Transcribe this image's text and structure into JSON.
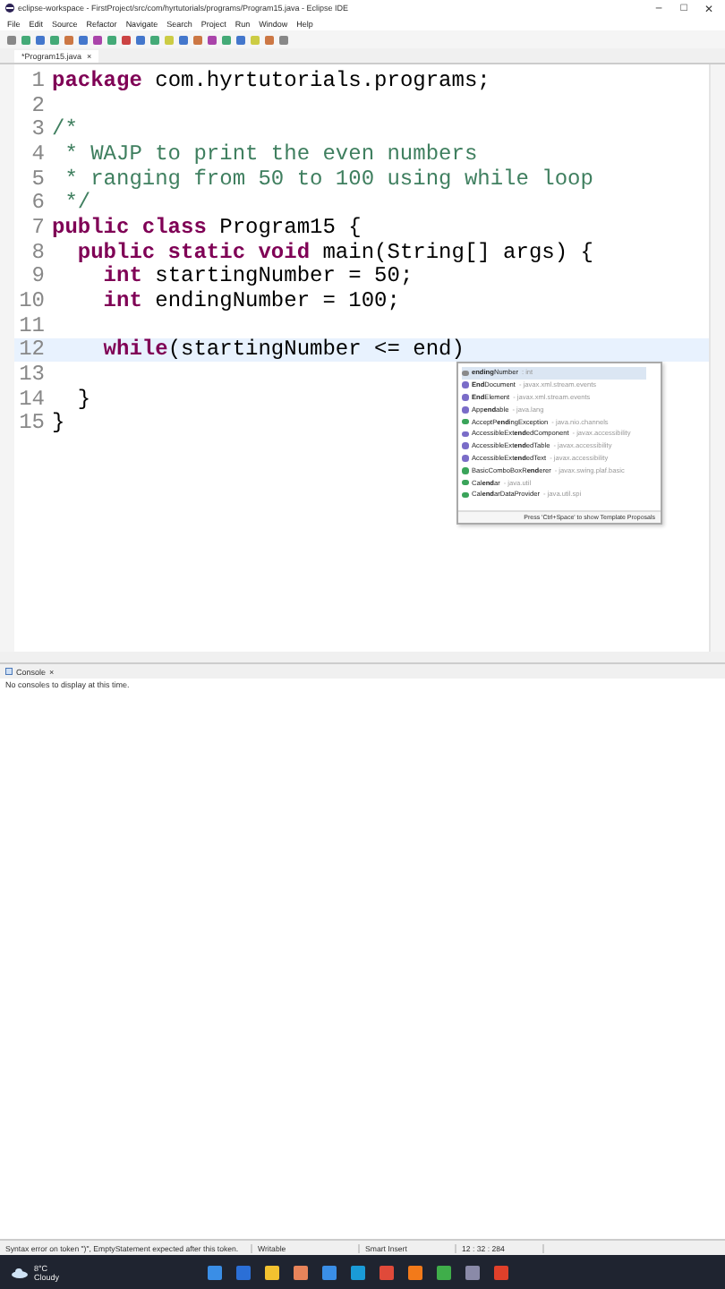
{
  "window": {
    "title": "eclipse-workspace - FirstProject/src/com/hyrtutorials/programs/Program15.java - Eclipse IDE",
    "controls": [
      "–",
      "□",
      "✕"
    ]
  },
  "menu": [
    "File",
    "Edit",
    "Source",
    "Refactor",
    "Navigate",
    "Search",
    "Project",
    "Run",
    "Window",
    "Help"
  ],
  "editor_tab": {
    "label": "*Program15.java",
    "close": "×"
  },
  "code_lines": [
    {
      "number": "1",
      "current": false,
      "segments": [
        {
          "kind": "keyword",
          "text": "package"
        },
        {
          "kind": "plain",
          "text": " com.hyrtutorials.programs;"
        }
      ]
    },
    {
      "number": "2",
      "current": false
    },
    {
      "number": "3",
      "current": false,
      "segments": [
        {
          "kind": "comment",
          "text": "/*"
        }
      ]
    },
    {
      "number": "4",
      "current": false,
      "segments": [
        {
          "kind": "comment",
          "text": " * WAJP to print the even numbers"
        }
      ]
    },
    {
      "number": "5",
      "current": false,
      "segments": [
        {
          "kind": "comment",
          "text": " * ranging from 50 to 100 using while loop"
        }
      ]
    },
    {
      "number": "6",
      "current": false,
      "segments": [
        {
          "kind": "comment",
          "text": " */"
        }
      ]
    },
    {
      "number": "7",
      "current": false,
      "segments": [
        {
          "kind": "keyword",
          "text": "public class"
        },
        {
          "kind": "plain",
          "text": " Program15 {"
        }
      ]
    },
    {
      "number": "8",
      "current": false,
      "segments": [
        {
          "kind": "keyword",
          "text": "  public static void"
        },
        {
          "kind": "plain",
          "text": " main(String[] args) {"
        }
      ]
    },
    {
      "number": "9",
      "current": false,
      "segments": [
        {
          "kind": "keyword",
          "text": "    int"
        },
        {
          "kind": "plain",
          "text": " startingNumber = 50;"
        }
      ]
    },
    {
      "number": "10",
      "current": false,
      "segments": [
        {
          "kind": "keyword",
          "text": "    int"
        },
        {
          "kind": "plain",
          "text": " endingNumber = 100;"
        }
      ]
    },
    {
      "number": "11",
      "current": false
    },
    {
      "number": "12",
      "current": true,
      "segments": [
        {
          "kind": "keyword",
          "text": "    while"
        },
        {
          "kind": "plain",
          "text": "(startingNumber <= end)"
        }
      ]
    },
    {
      "number": "13",
      "current": false
    },
    {
      "number": "14",
      "current": false,
      "segments": [
        {
          "kind": "plain",
          "text": "  }"
        }
      ]
    },
    {
      "number": "15",
      "current": false,
      "segments": [
        {
          "kind": "plain",
          "text": "}"
        }
      ]
    }
  ],
  "completion": {
    "items": [
      {
        "kind": "field",
        "name": "**ending**Number",
        "detail": ": int",
        "selected": true
      },
      {
        "kind": "interface",
        "name": "**End**Document",
        "detail": "- javax.xml.stream.events",
        "selected": false
      },
      {
        "kind": "interface",
        "name": "**End**Element",
        "detail": "- javax.xml.stream.events",
        "selected": false
      },
      {
        "kind": "interface",
        "name": "App**end**able",
        "detail": "- java.lang",
        "selected": false
      },
      {
        "kind": "class",
        "name": "AcceptP**end**ingException",
        "detail": "- java.nio.channels",
        "selected": false
      },
      {
        "kind": "interface",
        "name": "AccessibleExt**end**edComponent",
        "detail": "- javax.accessibility",
        "selected": false
      },
      {
        "kind": "interface",
        "name": "AccessibleExt**end**edTable",
        "detail": "- javax.accessibility",
        "selected": false
      },
      {
        "kind": "interface",
        "name": "AccessibleExt**end**edText",
        "detail": "- javax.accessibility",
        "selected": false
      },
      {
        "kind": "class",
        "name": "BasicComboBoxR**end**erer",
        "detail": "- javax.swing.plaf.basic",
        "selected": false
      },
      {
        "kind": "class",
        "name": "Cal**end**ar",
        "detail": "- java.util",
        "selected": false
      },
      {
        "kind": "class",
        "name": "Cal**end**arDataProvider",
        "detail": "- java.util.spi",
        "selected": false
      }
    ],
    "footer": "Press 'Ctrl+Space' to show Template Proposals"
  },
  "console": {
    "tab": "Console",
    "close": "×",
    "message": "No consoles to display at this time."
  },
  "status_bar": [
    "Syntax error on token \")\", EmptyStatement expected after this token.",
    "Writable",
    "Smart Insert",
    "12 : 32 : 284"
  ],
  "taskbar": {
    "temperature": "8°C",
    "weather": "Cloudy"
  }
}
